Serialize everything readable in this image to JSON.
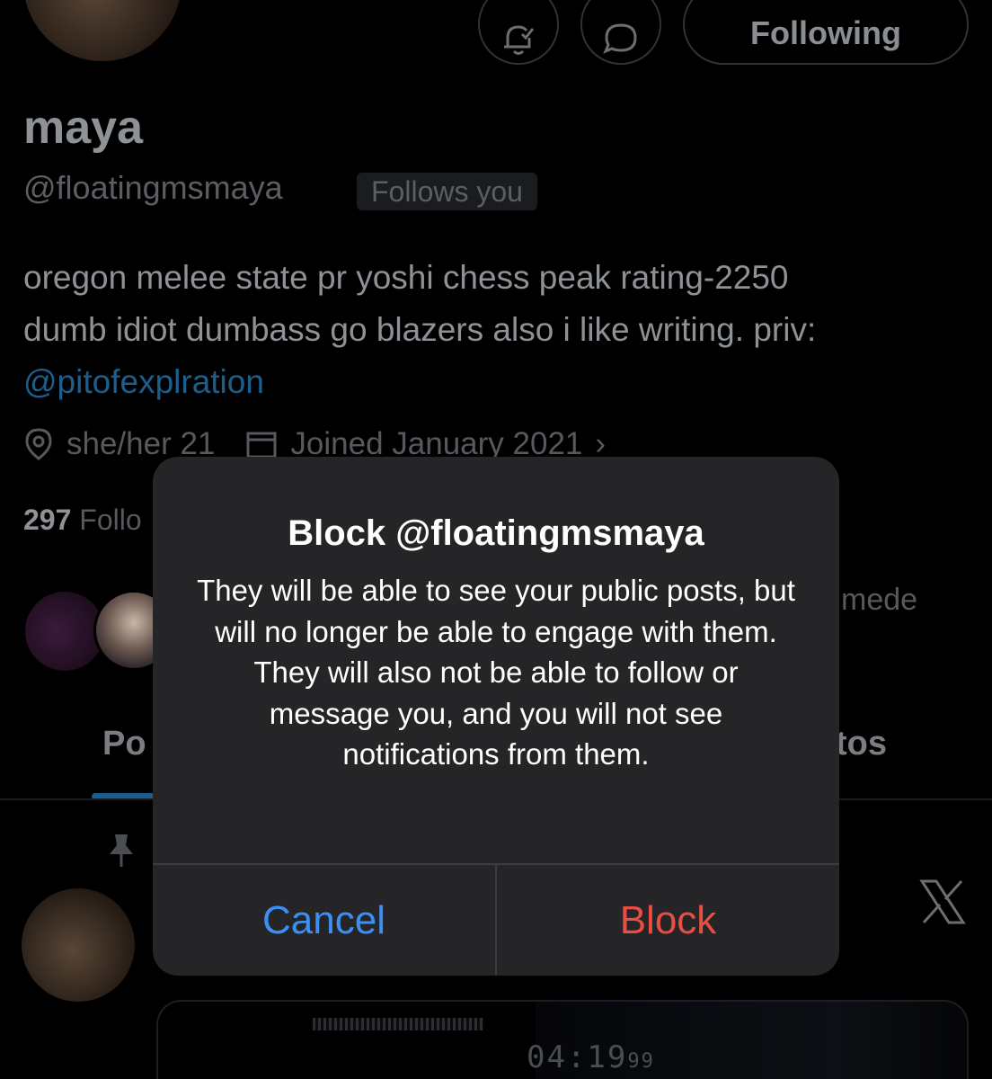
{
  "profile": {
    "name": "maya",
    "handle": "@floatingmsmaya",
    "follows_badge": "Follows you",
    "following_label": "Following",
    "bio_line1": "oregon melee state pr yoshi chess peak rating-2250",
    "bio_line2": "dumb idiot dumbass go blazers also i like writing. priv:",
    "bio_link": "@pitofexplration",
    "location": "she/her 21",
    "joined": "Joined January 2021",
    "following_count": "297",
    "following_label_partial": "Follo",
    "mutuals_text_partial": "mede"
  },
  "tabs": {
    "posts_partial": "Po",
    "photos_partial": "tos"
  },
  "post": {
    "clock_main": "04:19",
    "clock_small": "99"
  },
  "dialog": {
    "title": "Block @floatingmsmaya",
    "message": "They will be able to see your public posts, but will no longer be able to engage with them. They will also not be able to follow or message you, and you will not see notifications from them.",
    "cancel_label": "Cancel",
    "block_label": "Block"
  },
  "colors": {
    "cancel": "#3b8ff5",
    "block": "#ea4d44",
    "dialog_bg": "#252527",
    "link": "#1c5e8c"
  },
  "icons": {
    "notify": "bell-plus-icon",
    "message": "message-bubble-icon",
    "location": "location-pin-icon",
    "calendar": "calendar-icon",
    "pin": "pin-icon",
    "brand": "x-logo-icon"
  }
}
